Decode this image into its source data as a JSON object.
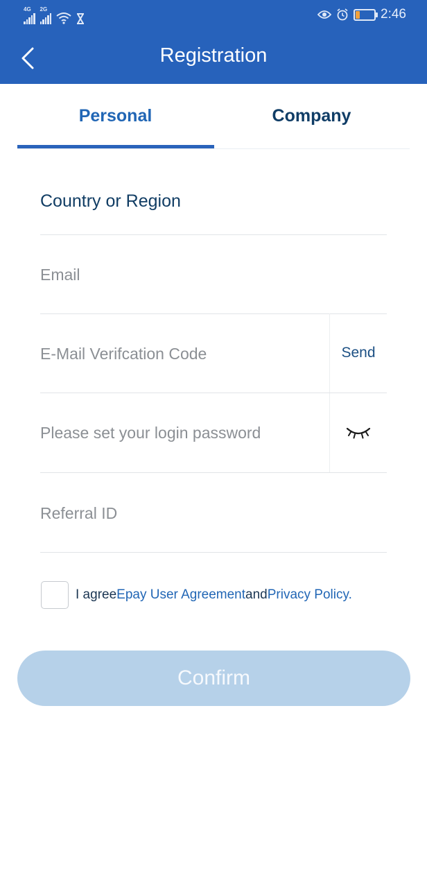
{
  "status_bar": {
    "network_1": "4G",
    "network_2": "2G",
    "time": "2:46",
    "battery_level": 0.2
  },
  "header": {
    "title": "Registration",
    "back_icon": "chevron-left-icon"
  },
  "tabs": [
    {
      "label": "Personal",
      "active": true
    },
    {
      "label": "Company",
      "active": false
    }
  ],
  "form": {
    "country_label": "Country or Region",
    "email_placeholder": "Email",
    "code_placeholder": "E-Mail Verifcation Code",
    "send_label": "Send",
    "password_placeholder": "Please set your login password",
    "password_toggle_icon": "eye-closed-icon",
    "referral_placeholder": "Referral ID"
  },
  "agreement": {
    "prefix": "I agree",
    "link1": "Epay User Agreement",
    "middle": "and",
    "link2": "Privacy Policy",
    "suffix": ".",
    "checked": false
  },
  "confirm_label": "Confirm",
  "colors": {
    "primary": "#2762bb",
    "tab_active": "#2166b5",
    "tab_inactive": "#103d66",
    "confirm_disabled": "#b6d1e9"
  }
}
